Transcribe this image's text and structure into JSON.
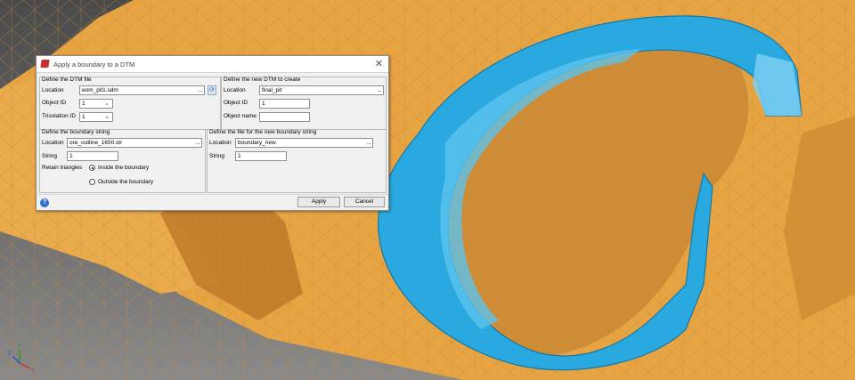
{
  "dialog": {
    "title": "Apply a boundary to a DTM",
    "close_glyph": "✕",
    "dtm_group": {
      "title": "Define the DTM file",
      "location_label": "Location",
      "location_value": "eom_pit1.sdm",
      "object_id_label": "Object ID",
      "object_id_value": "1",
      "trisolation_label": "Trisolation ID",
      "trisolation_value": "1"
    },
    "new_dtm_group": {
      "title": "Define the new DTM to create",
      "location_label": "Location",
      "location_value": "final_pit",
      "object_id_label": "Object ID",
      "object_id_value": "1",
      "object_name_label": "Object name",
      "object_name_value": ""
    },
    "boundary_group": {
      "title": "Define the boundary string",
      "location_label": "Location",
      "location_value": "ore_outline_1650.str",
      "string_label": "String",
      "string_value": "1",
      "retain_label": "Retain triangles",
      "option_inside": "Inside the boundary",
      "option_outside": "Outside the boundary",
      "selected": "inside"
    },
    "new_boundary_group": {
      "title": "Define the file for the new boundary string",
      "location_label": "Location",
      "location_value": "boundary_new",
      "string_label": "String",
      "string_value": "1"
    },
    "browse_glyph": "...",
    "dropdown_glyph": "⌄",
    "help_glyph": "?",
    "refresh_glyph": "⟳",
    "apply_label": "Apply",
    "cancel_label": "Cancel"
  },
  "axes": {
    "x": "X",
    "y": "Y",
    "z": "Z"
  },
  "colors": {
    "terrain": "#e9a744",
    "terrain_dark": "#b8731f",
    "pit_boundary": "#2aa8e0",
    "background": "#6a6a6a"
  }
}
